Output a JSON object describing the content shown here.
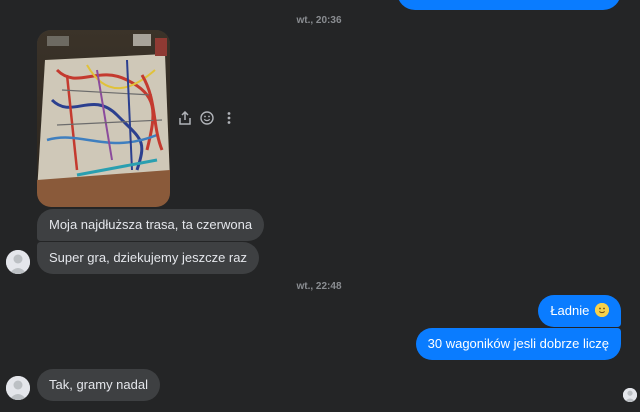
{
  "timestamps": [
    "wt., 20:36",
    "wt., 22:48"
  ],
  "messages": {
    "m1": "Moja najdłuższa trasa, ta czerwona",
    "m2": "Super gra, dziekujemy jeszcze raz",
    "m3": "Ładnie",
    "m4": "30 wagoników jesli dobrze liczę",
    "m5": "Tak, gramy nadal"
  },
  "icons": {
    "share": "share-icon",
    "react": "smiley-icon",
    "more": "more-vertical-icon",
    "emoji_in_message": "slightly-smiling-face"
  },
  "colors": {
    "background": "#242526",
    "incoming_bubble": "#3e4042",
    "outgoing_bubble": "#0a7cff",
    "timestamp": "#8a8d91"
  }
}
